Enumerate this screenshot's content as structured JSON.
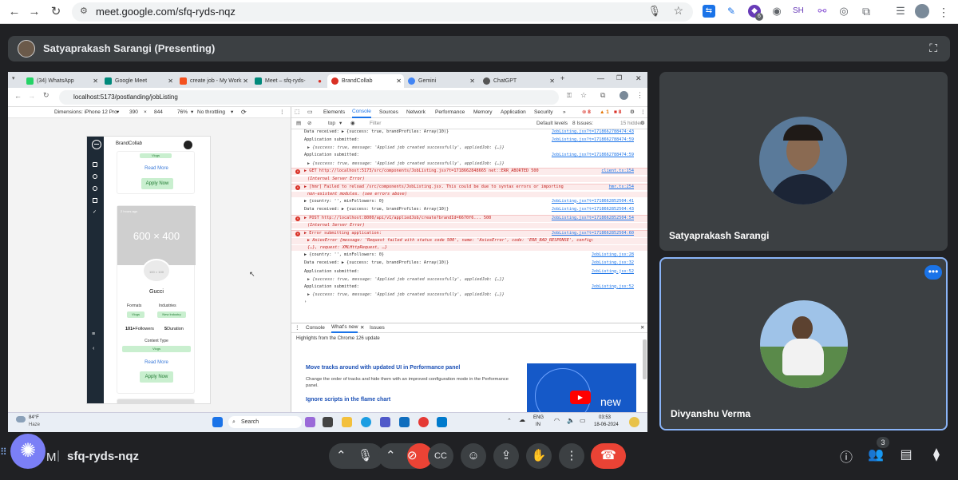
{
  "browser": {
    "url": "meet.google.com/sfq-ryds-nqz",
    "profile_initials": "SH",
    "ext_badge": "6"
  },
  "presenter": {
    "label": "Satyaprakash Sarangi (Presenting)"
  },
  "shared_screen": {
    "tabs": [
      {
        "label": "(34) WhatsApp",
        "color": "#25d366"
      },
      {
        "label": "Google Meet",
        "color": "#00897b"
      },
      {
        "label": "create job - My Work",
        "color": "#f4511e"
      },
      {
        "label": "Meet – sfq-ryds-",
        "color": "#00897b"
      },
      {
        "label": "BrandCollab",
        "color": "#d93025"
      },
      {
        "label": "Gemini",
        "color": "#4285f4"
      },
      {
        "label": "ChatGPT",
        "color": "#555555"
      }
    ],
    "address": "localhost:5173/postlanding/jobListing",
    "device_toolbar": {
      "dimensions_label": "Dimensions: iPhone 12 Pro",
      "width": "390",
      "height": "844",
      "zoom": "76%",
      "throttling": "No throttling"
    },
    "phone": {
      "brand": "BrandCollab",
      "read_more": "Read More",
      "apply_now": "Apply Now",
      "time_ago": "2 hours ago",
      "placeholder": "600 × 400",
      "logo_placeholder": "100 × 100",
      "brand_name": "Gucci",
      "formats_label": "Formats",
      "industries_label": "Industries",
      "format_tag": "Vlogs",
      "industry_tag": "New Industry",
      "followers": "101+",
      "followers_label": "Followers",
      "duration": "5",
      "duration_label": "Duration",
      "content_type_label": "Content Type",
      "content_tag": "Vlogs"
    },
    "devtools": {
      "tabs": [
        "Elements",
        "Console",
        "Sources",
        "Network",
        "Performance",
        "Memory",
        "Application",
        "Security",
        "»"
      ],
      "error_count": "8",
      "warn_count": "1",
      "filter_context": "top",
      "filter_placeholder": "Filter",
      "default_levels": "Default levels",
      "issues": "8 Issues:",
      "issues_count": "8",
      "hidden": "15 hidden",
      "logs": [
        {
          "type": "log",
          "text": "Data received:  ▶ {success: true, brandProfiles: Array(10)}",
          "src": "JobListing.jsx?t=1718662788474:43"
        },
        {
          "type": "log",
          "text": "Application submitted:",
          "src": "JobListing.jsx?t=1718662788474:59"
        },
        {
          "type": "sub",
          "text": "▶ {success: true, message: 'Applied job created successfully', appliedJob: {…}}",
          "src": ""
        },
        {
          "type": "log",
          "text": "Application submitted:",
          "src": "JobListing.jsx?t=1718662788474:59"
        },
        {
          "type": "sub",
          "text": "▶ {success: true, message: 'Applied job created successfully', appliedJob: {…}}",
          "src": ""
        },
        {
          "type": "err",
          "text": "▶ GET http://localhost:5173/src/components/JobListing.jsx?t=1718662848665 net::ERR_ABORTED 500",
          "src": "client.ts:154"
        },
        {
          "type": "errsub",
          "text": "(Internal Server Error)",
          "src": ""
        },
        {
          "type": "err",
          "text": "▶ [hmr] Failed to reload /src/components/JobListing.jsx. This could be due to syntax errors or importing",
          "src": "hmr.ts:254"
        },
        {
          "type": "errsub",
          "text": "non-existent modules. (see errors above)",
          "src": ""
        },
        {
          "type": "log",
          "text": "▶ {country: '', minFollowers: 0}",
          "src": "JobListing.jsx?t=1718662852504:41"
        },
        {
          "type": "log",
          "text": "Data received:  ▶ {success: true, brandProfiles: Array(10)}",
          "src": "JobListing.jsx?t=1718662852504:43"
        },
        {
          "type": "err",
          "text": "▶ POST http://localhost:8000/api/v1/appliedJob/create?brandId=6670f6... 500",
          "src": "JobListing.jsx?t=1718662852504:54"
        },
        {
          "type": "errsub",
          "text": "(Internal Server Error)",
          "src": ""
        },
        {
          "type": "err",
          "text": "▶ Error submitting application:",
          "src": "JobListing.jsx?t=1718662852504:60"
        },
        {
          "type": "errsub",
          "text": "▶ AxiosError {message: 'Request failed with status code 500', name: 'AxiosError', code: 'ERR_BAD_RESPONSE', config:",
          "src": ""
        },
        {
          "type": "errsub",
          "text": "{…}, request: XMLHttpRequest, …}",
          "src": ""
        },
        {
          "type": "log",
          "text": "▶ {country: '', minFollowers: 0}",
          "src": "JobListing.jsx:28"
        },
        {
          "type": "log",
          "text": "Data received:  ▶ {success: true, brandProfiles: Array(10)}",
          "src": "JobListing.jsx:32"
        },
        {
          "type": "log",
          "text": "Application submitted:",
          "src": "JobListing.jsx:52"
        },
        {
          "type": "sub",
          "text": "▶ {success: true, message: 'Applied job created successfully', appliedJob: {…}}",
          "src": ""
        },
        {
          "type": "log",
          "text": "Application submitted:",
          "src": "JobListing.jsx:52"
        },
        {
          "type": "sub",
          "text": "▶ {success: true, message: 'Applied job created successfully', appliedJob: {…}}",
          "src": ""
        },
        {
          "type": "prompt",
          "text": "›",
          "src": ""
        }
      ],
      "drawer_tabs": [
        "Console",
        "What's new",
        "Issues"
      ],
      "highlights": "Highlights from the Chrome 126 update",
      "wn_title1": "Move tracks around with updated UI in Performance panel",
      "wn_desc1": "Change the order of tracks and hide them with an improved configuration mode in the Performance panel.",
      "wn_title2": "Ignore scripts in the flame chart",
      "wn_video_label": "new"
    },
    "taskbar": {
      "temp": "84°F",
      "weather": "Haze",
      "search": "Search",
      "lang": "ENG",
      "region": "IN",
      "time": "03:53",
      "date": "18-06-2024"
    }
  },
  "participants": [
    {
      "name": "Satyaprakash Sarangi"
    },
    {
      "name": "Divyanshu Verma"
    }
  ],
  "meeting": {
    "time_fragment": "M",
    "code": "sfq-ryds-nqz",
    "people_count": "3",
    "end_color": "#ea4335"
  }
}
